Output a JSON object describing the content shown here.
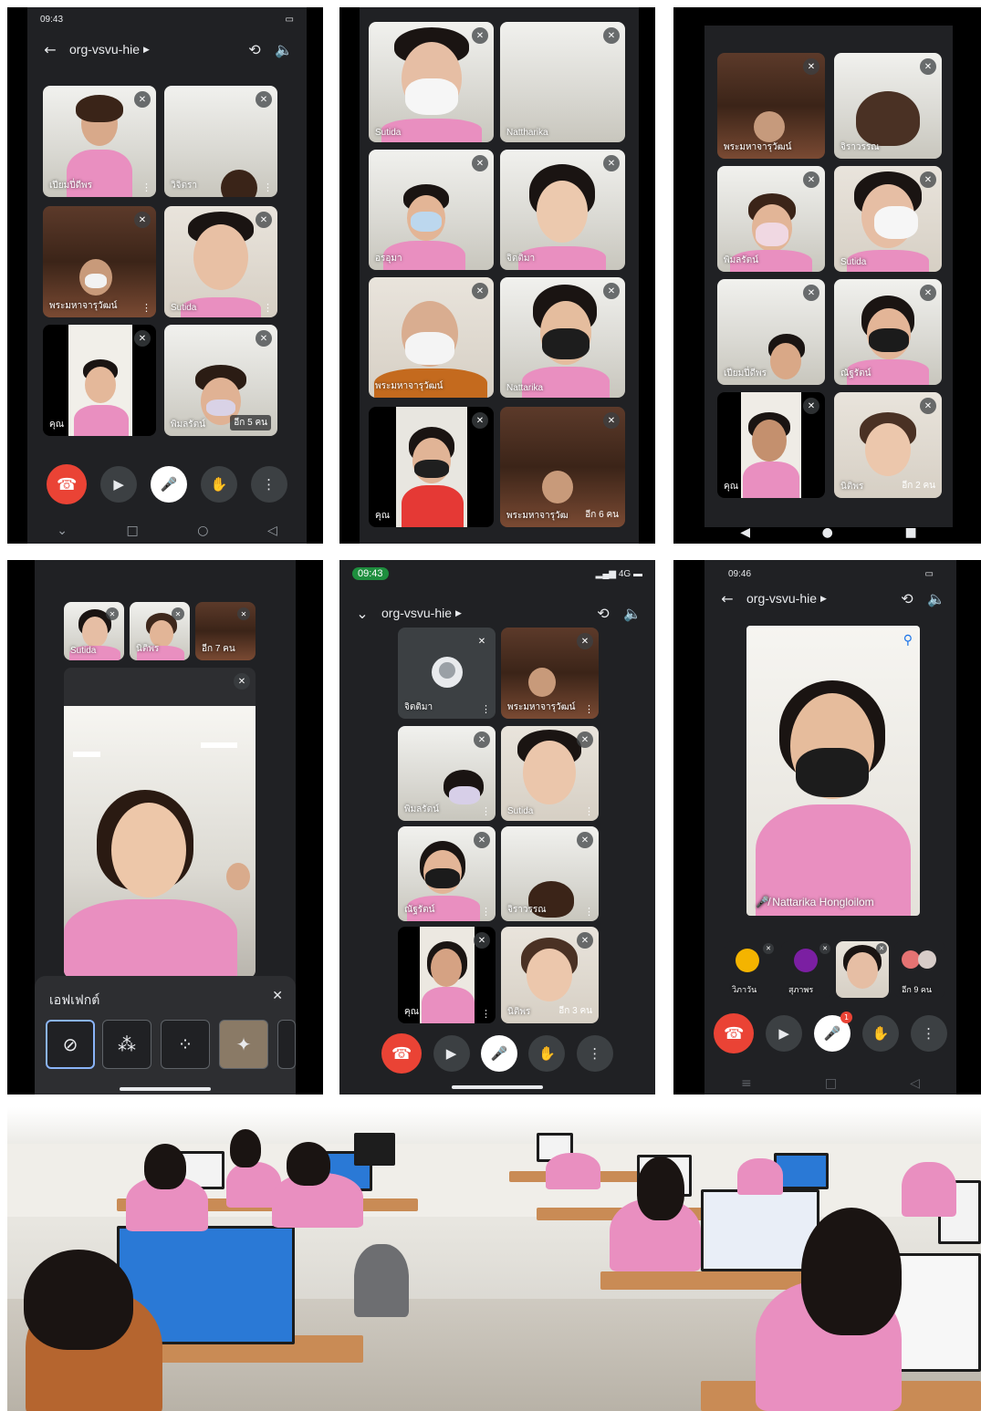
{
  "meet": {
    "room_code": "org-vsvu-hie",
    "mute_glyph": "🎤̸"
  },
  "panel1": {
    "status_time": "09:43",
    "tiles": [
      {
        "name": "เปียมปี่ดีพร"
      },
      {
        "name": "วิจิตรา"
      },
      {
        "name": "พระมหาจารุวัฒน์"
      },
      {
        "name": "Sutida"
      },
      {
        "name": "คุณ"
      },
      {
        "name": "พิมลรัตน์",
        "extra": "อีก 5 คน"
      }
    ]
  },
  "panel2": {
    "tiles": [
      {
        "name": "Sutida"
      },
      {
        "name": "Nattharika"
      },
      {
        "name": "อรอุมา"
      },
      {
        "name": "จิตติมา"
      },
      {
        "name": "พระมหาจารุวัฒน์"
      },
      {
        "name": "Nattarika"
      },
      {
        "name": "คุณ"
      },
      {
        "name": "พระมหาจารุวัฒ",
        "extra": "อีก 6 คน"
      }
    ]
  },
  "panel3": {
    "tiles": [
      {
        "name": "พระมหาจารุวัฒน์"
      },
      {
        "name": "จิราวรรณ"
      },
      {
        "name": "พิมลรัตน์"
      },
      {
        "name": "Sutida"
      },
      {
        "name": "เปียมปี่ดีพร"
      },
      {
        "name": "ณัฐรัตน์"
      },
      {
        "name": "คุณ"
      },
      {
        "name": "นิติพร",
        "extra": "อีก 2 คน"
      }
    ]
  },
  "panel4": {
    "thumbs": [
      {
        "name": "Sutida"
      },
      {
        "name": "นิติพร"
      },
      {
        "name": "อีก 7 คน"
      }
    ],
    "effects_title": "เอฟเฟกต์"
  },
  "panel5": {
    "status_time": "09:43",
    "network": "4G",
    "tiles": [
      {
        "name": "จิตติมา"
      },
      {
        "name": "พระมหาจารุวัฒน์"
      },
      {
        "name": "พิมลรัตน์"
      },
      {
        "name": "Sutida"
      },
      {
        "name": "ณัฐรัตน์"
      },
      {
        "name": "จิราวรรณ"
      },
      {
        "name": "คุณ"
      },
      {
        "name": "นิติพร",
        "extra": "อีก 3 คน"
      }
    ]
  },
  "panel6": {
    "status_time": "09:46",
    "pinned_name": "Nattarika Hongloilom",
    "thumbs": [
      {
        "name": "วิภาวัน"
      },
      {
        "name": "สุภาพร"
      },
      {
        "name": ""
      },
      {
        "name": "อีก 9 คน"
      }
    ],
    "raise_badge": "1"
  },
  "colors": {
    "meet_bg": "#202124",
    "end_call": "#ea4335",
    "uniform_pink": "#e98fc0",
    "accent_blue": "#8ab4f8"
  },
  "icons": {
    "back": "arrow-left-icon",
    "camera_switch": "camera-switch-icon",
    "speaker": "speaker-icon",
    "end_call": "phone-hangup-icon",
    "video": "video-icon",
    "mic_off": "mic-off-icon",
    "hand": "raise-hand-icon",
    "more": "more-vert-icon"
  }
}
